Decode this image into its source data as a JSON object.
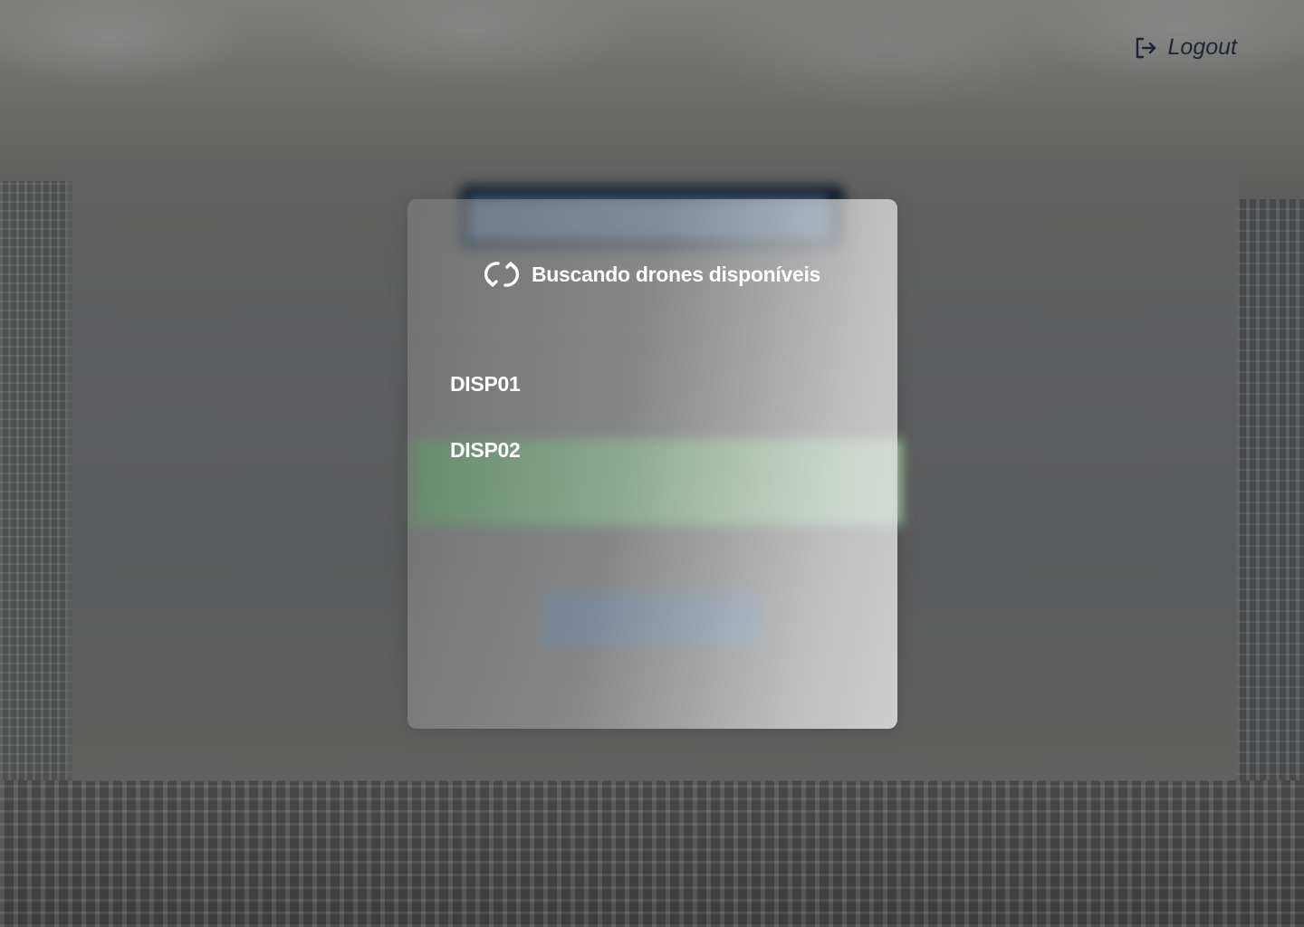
{
  "topbar": {
    "logout_label": "Logout",
    "logout_icon": "logout-icon"
  },
  "modal": {
    "title": "Buscando drones disponíveis",
    "title_icon": "refresh-icon",
    "drones": [
      {
        "label": "DISP01"
      },
      {
        "label": "DISP02"
      }
    ]
  },
  "colors": {
    "overlay": "#5a5a5a",
    "header_dark": "#0f1d2d",
    "accent_green": "#3e8a48",
    "accent_blue": "#47648a",
    "text_dark": "#1c2633",
    "text_light": "#ffffff"
  }
}
